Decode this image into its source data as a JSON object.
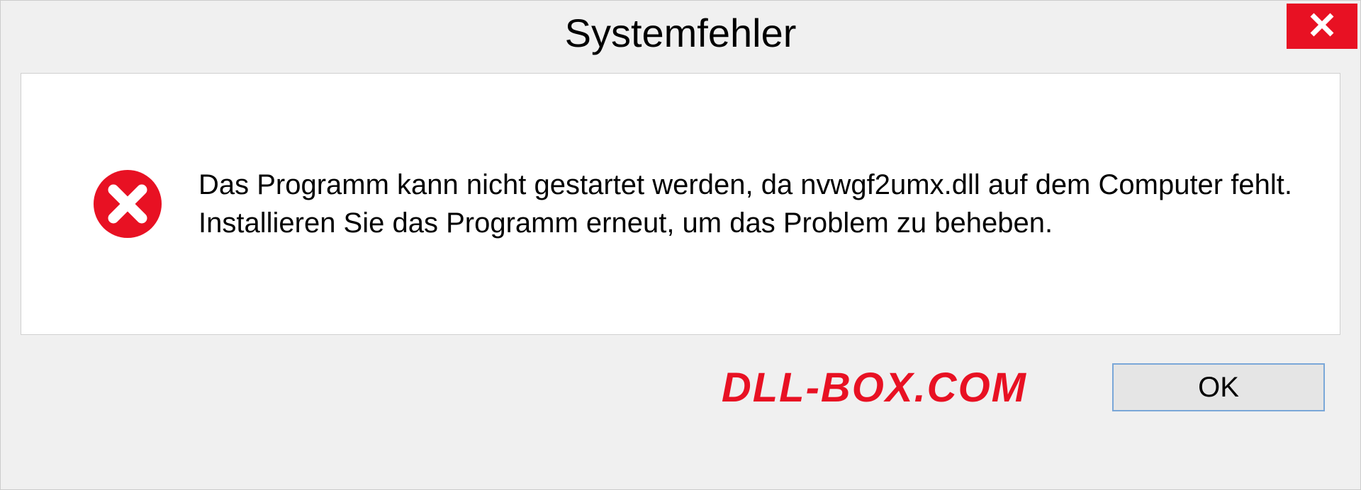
{
  "dialog": {
    "title": "Systemfehler",
    "message": "Das Programm kann nicht gestartet werden, da nvwgf2umx.dll auf dem Computer fehlt. Installieren Sie das Programm erneut, um das Problem zu beheben.",
    "ok_label": "OK"
  },
  "watermark": "DLL-BOX.COM"
}
